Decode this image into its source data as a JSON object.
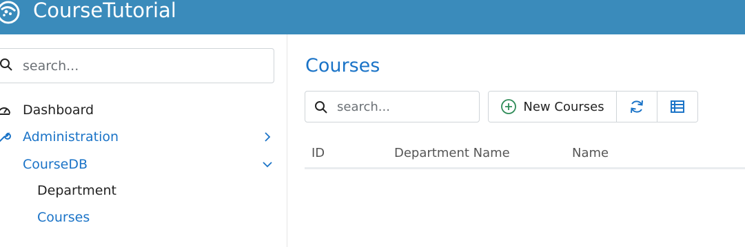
{
  "app": {
    "title": "CourseTutorial"
  },
  "sidebar": {
    "search_placeholder": "search...",
    "items": [
      {
        "label": "Dashboard",
        "icon": "dashboard-gauge-icon"
      },
      {
        "label": "Administration",
        "icon": "wrench-icon",
        "chevron": "chevron-right-icon"
      },
      {
        "label": "CourseDB",
        "chevron": "chevron-down-icon"
      }
    ],
    "subitems": [
      {
        "label": "Department"
      },
      {
        "label": "Courses",
        "active": true
      }
    ]
  },
  "main": {
    "title": "Courses",
    "search_placeholder": "search...",
    "toolbar": {
      "new_label": "New Courses",
      "new_icon": "plus-circle-icon",
      "refresh_icon": "refresh-icon",
      "columns_icon": "table-columns-icon"
    },
    "table": {
      "columns": [
        "ID",
        "Department Name",
        "Name"
      ],
      "rows": []
    }
  },
  "colors": {
    "topbar": "#3a8bbb",
    "accent": "#1a73c7",
    "plus_icon": "#2e8b57"
  }
}
